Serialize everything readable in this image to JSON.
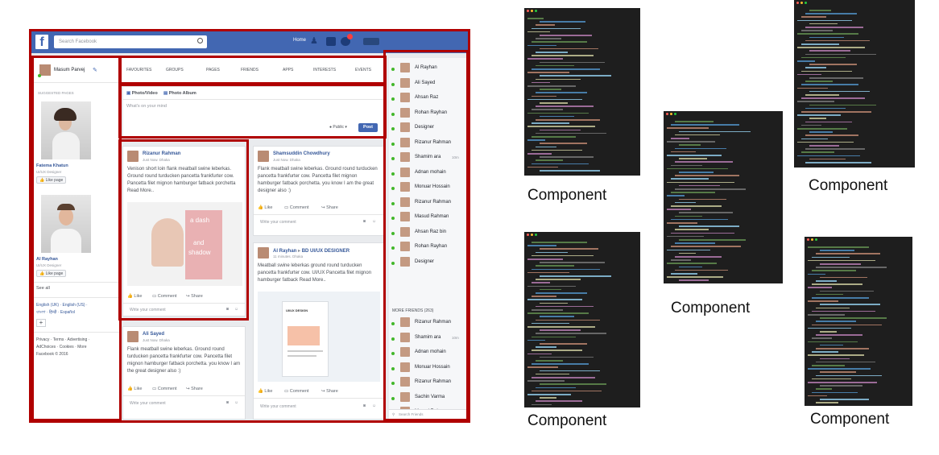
{
  "facebook": {
    "search_placeholder": "Search Facebook",
    "nav_home": "Home",
    "profile_name": "Masum Parvej",
    "suggested_title": "SUGGESTED PAGES",
    "suggest1_name": "Fatema Khatun",
    "suggest1_role": "UI/UX Designer",
    "suggest2_name": "Al Rayhan",
    "suggest2_role": "UI/UX Designer",
    "like_page": "Like page",
    "see_all": "See all",
    "lang1": "English (UK) · English (US) ·",
    "lang2": "বাংলা · हिन्दी · Español",
    "footer1": "Privacy · Terms · Advertising ·",
    "footer2": "AdChoices · Cookies · More",
    "footer3": "Facebook © 2016",
    "tabs": [
      "FAVOURITES",
      "GROUPS",
      "PAGES",
      "FRIENDS",
      "APPS",
      "INTERESTS",
      "EVENTS"
    ],
    "composer_photo": "Photo/Video",
    "composer_album": "Photo Album",
    "composer_placeholder": "What's on your mind",
    "composer_public": "Public ▾",
    "composer_post": "Post",
    "posts": [
      {
        "name": "Rizanur Rahman",
        "meta": "Just Now. Dhaka",
        "text": "Venison short loin flank meatball swine leberkas. Ground round turducken pancetta frankfurter cow. Pancetta filet mignon hamburger fatback porchetta Read More..",
        "img_text1": "a dash",
        "img_text2": "and",
        "img_text3": "shadow"
      },
      {
        "name": "Shamsuddin Chowdhury",
        "meta": "Just Now. Dhaka",
        "text": "Flank meatball swine leberkas. Ground round turducken pancetta frankfurter cow. Pancetta filet mignon hamburger fatback porchetta. you know I am the great designer also :)"
      },
      {
        "name": "Al Rayhan",
        "name_extra": "BD UI/UX DESIGNER",
        "meta": "11 minutes. Dhaka",
        "text": "Meatball swine leberkas ground round turducken pancetta frankfurter cow. UI/UX Pancetta filet mignon hamburger fatback Read More..",
        "img_text": "UI/UX DESIGN"
      },
      {
        "name": "Ali Sayed",
        "meta": "Just Now. Dhaka",
        "text": "Flank meatball swine leberkas. Ground round turducken pancetta frankfurter cow. Pancetta filet mignon hamburger fatback porchetta. you know I am the great designer also :)"
      }
    ],
    "action_like": "Like",
    "action_comment": "Comment",
    "action_share": "Share",
    "write_comment": "Write your comment",
    "friends": [
      "Al Rayhan",
      "Ali Sayed",
      "Ahsan Raz",
      "Rohan Rayhan",
      "Designer",
      "Rizanur Rahman",
      "Shamim ara",
      "Adnan mohain",
      "Monuar Hossain",
      "Rizanur Rahman",
      "Masud Rahman",
      "Ahsan Raz bin",
      "Rohan Rayhan",
      "Designer"
    ],
    "more_friends": "MORE FRIENDS (263)",
    "friends2": [
      "Rizanur Rahman",
      "Shamim ara",
      "Adnan mohain",
      "Monuar Hossain",
      "Rizanur Rahman",
      "Sachin Varma",
      "Masud Rahman"
    ],
    "friend_time": "10m",
    "search_friends": "Search Friends"
  },
  "component_label": "Component",
  "colors": {
    "highlight": "#b00000",
    "fb_blue": "#4267b2",
    "code_bg": "#1e1e1e"
  }
}
